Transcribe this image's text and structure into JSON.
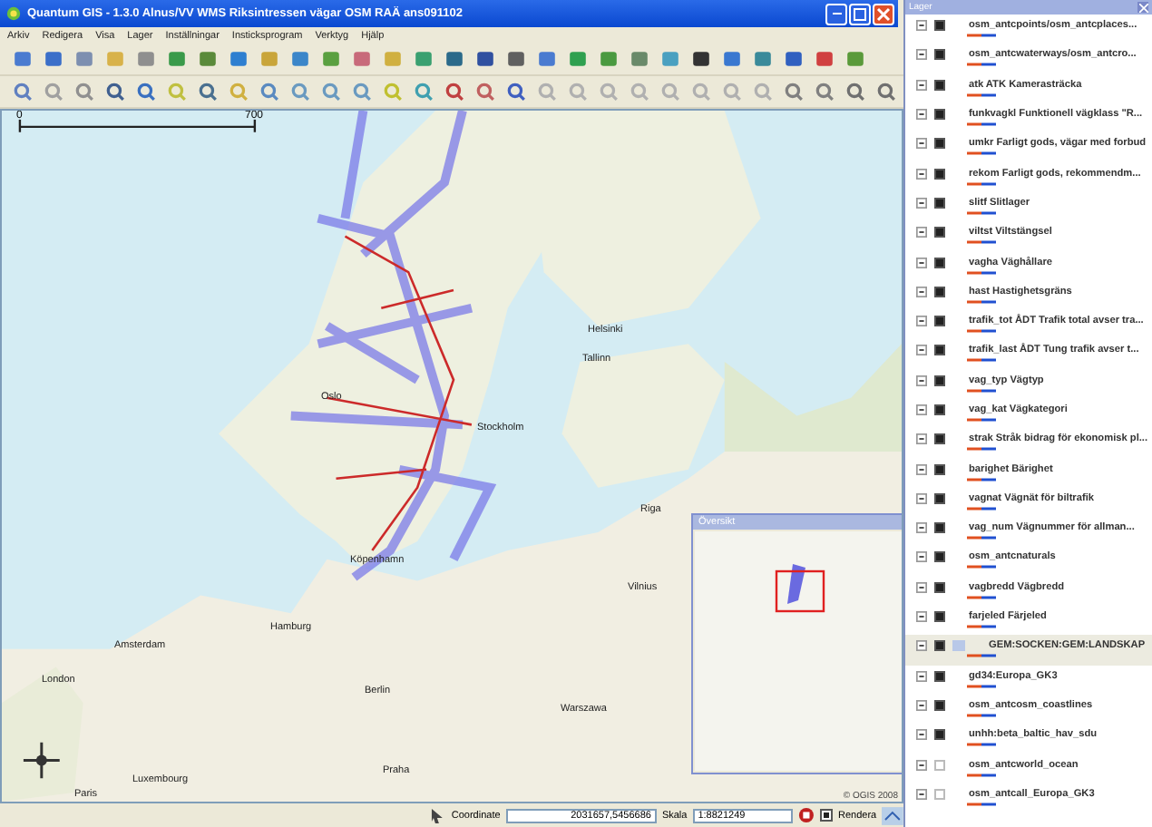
{
  "window": {
    "title": "Quantum GIS - 1.3.0 Alnus/VV WMS Riksintressen vägar OSM RAÄ ans091102"
  },
  "menu": [
    "Arkiv",
    "Redigera",
    "Visa",
    "Lager",
    "Inställningar",
    "Insticksprogram",
    "Verktyg",
    "Hjälp"
  ],
  "map": {
    "scale_start": "0",
    "scale_end": "700",
    "copyright": "© OGIS 2008",
    "labels": [
      "Helsinki",
      "Tallinn",
      "Oslo",
      "Stockholm",
      "Riga",
      "Köpenhamn",
      "Vilnius",
      "Hamburg",
      "Amsterdam",
      "London",
      "Berlin",
      "Warszawa",
      "Praha",
      "Luxembourg",
      "Paris"
    ]
  },
  "overview": {
    "title": "Översikt"
  },
  "legend": {
    "title": "Lager",
    "layers": [
      {
        "name": "osm_antcpoints/osm_antcplaces...",
        "visible": true,
        "selected": false
      },
      {
        "name": "osm_antcwaterways/osm_antcro...",
        "visible": true,
        "selected": false
      },
      {
        "name": "atk ATK Kamerasträcka",
        "visible": true,
        "selected": false
      },
      {
        "name": "funkvagkl Funktionell vägklass \"R...",
        "visible": true,
        "selected": false
      },
      {
        "name": "umkr Farligt gods, vägar med forbud",
        "visible": true,
        "selected": false
      },
      {
        "name": "rekom Farligt gods, rekommendm...",
        "visible": true,
        "selected": false
      },
      {
        "name": "slitf Slitlager",
        "visible": true,
        "selected": false
      },
      {
        "name": "viltst Viltstängsel",
        "visible": true,
        "selected": false
      },
      {
        "name": "vagha Väghållare",
        "visible": true,
        "selected": false
      },
      {
        "name": "hast Hastighetsgräns",
        "visible": true,
        "selected": false
      },
      {
        "name": "trafik_tot ÅDT Trafik total avser tra...",
        "visible": true,
        "selected": false
      },
      {
        "name": "trafik_last ÅDT Tung trafik avser t...",
        "visible": true,
        "selected": false
      },
      {
        "name": "vag_typ Vägtyp",
        "visible": true,
        "selected": false
      },
      {
        "name": "vag_kat Vägkategori",
        "visible": true,
        "selected": false
      },
      {
        "name": "strak Stråk bidrag för ekonomisk pl...",
        "visible": true,
        "selected": false
      },
      {
        "name": "barighet Bärighet",
        "visible": true,
        "selected": false
      },
      {
        "name": "vagnat Vägnät för biltrafik",
        "visible": true,
        "selected": false
      },
      {
        "name": "vag_num Vägnummer för allman...",
        "visible": true,
        "selected": false
      },
      {
        "name": "osm_antcnaturals",
        "visible": true,
        "selected": false
      },
      {
        "name": "vagbredd Vägbredd",
        "visible": true,
        "selected": false
      },
      {
        "name": "farjeled Färjeled",
        "visible": true,
        "selected": false
      },
      {
        "name": "GEM:SOCKEN:GEM:LANDSKAP",
        "visible": true,
        "selected": true
      },
      {
        "name": "gd34:Europa_GK3",
        "visible": true,
        "selected": false
      },
      {
        "name": "osm_antcosm_coastlines",
        "visible": true,
        "selected": false
      },
      {
        "name": "unhh:beta_baltic_hav_sdu",
        "visible": true,
        "selected": false
      },
      {
        "name": "osm_antcworld_ocean",
        "visible": false,
        "selected": false
      },
      {
        "name": "osm_antcall_Europa_GK3",
        "visible": false,
        "selected": false
      }
    ]
  },
  "status_bar": {
    "coordinate_label": "Coordinate",
    "coordinate": "2031657,5456686",
    "scale_label": "Skala",
    "scale": "1:8821249",
    "render_label": "Rendera",
    "render": true
  }
}
